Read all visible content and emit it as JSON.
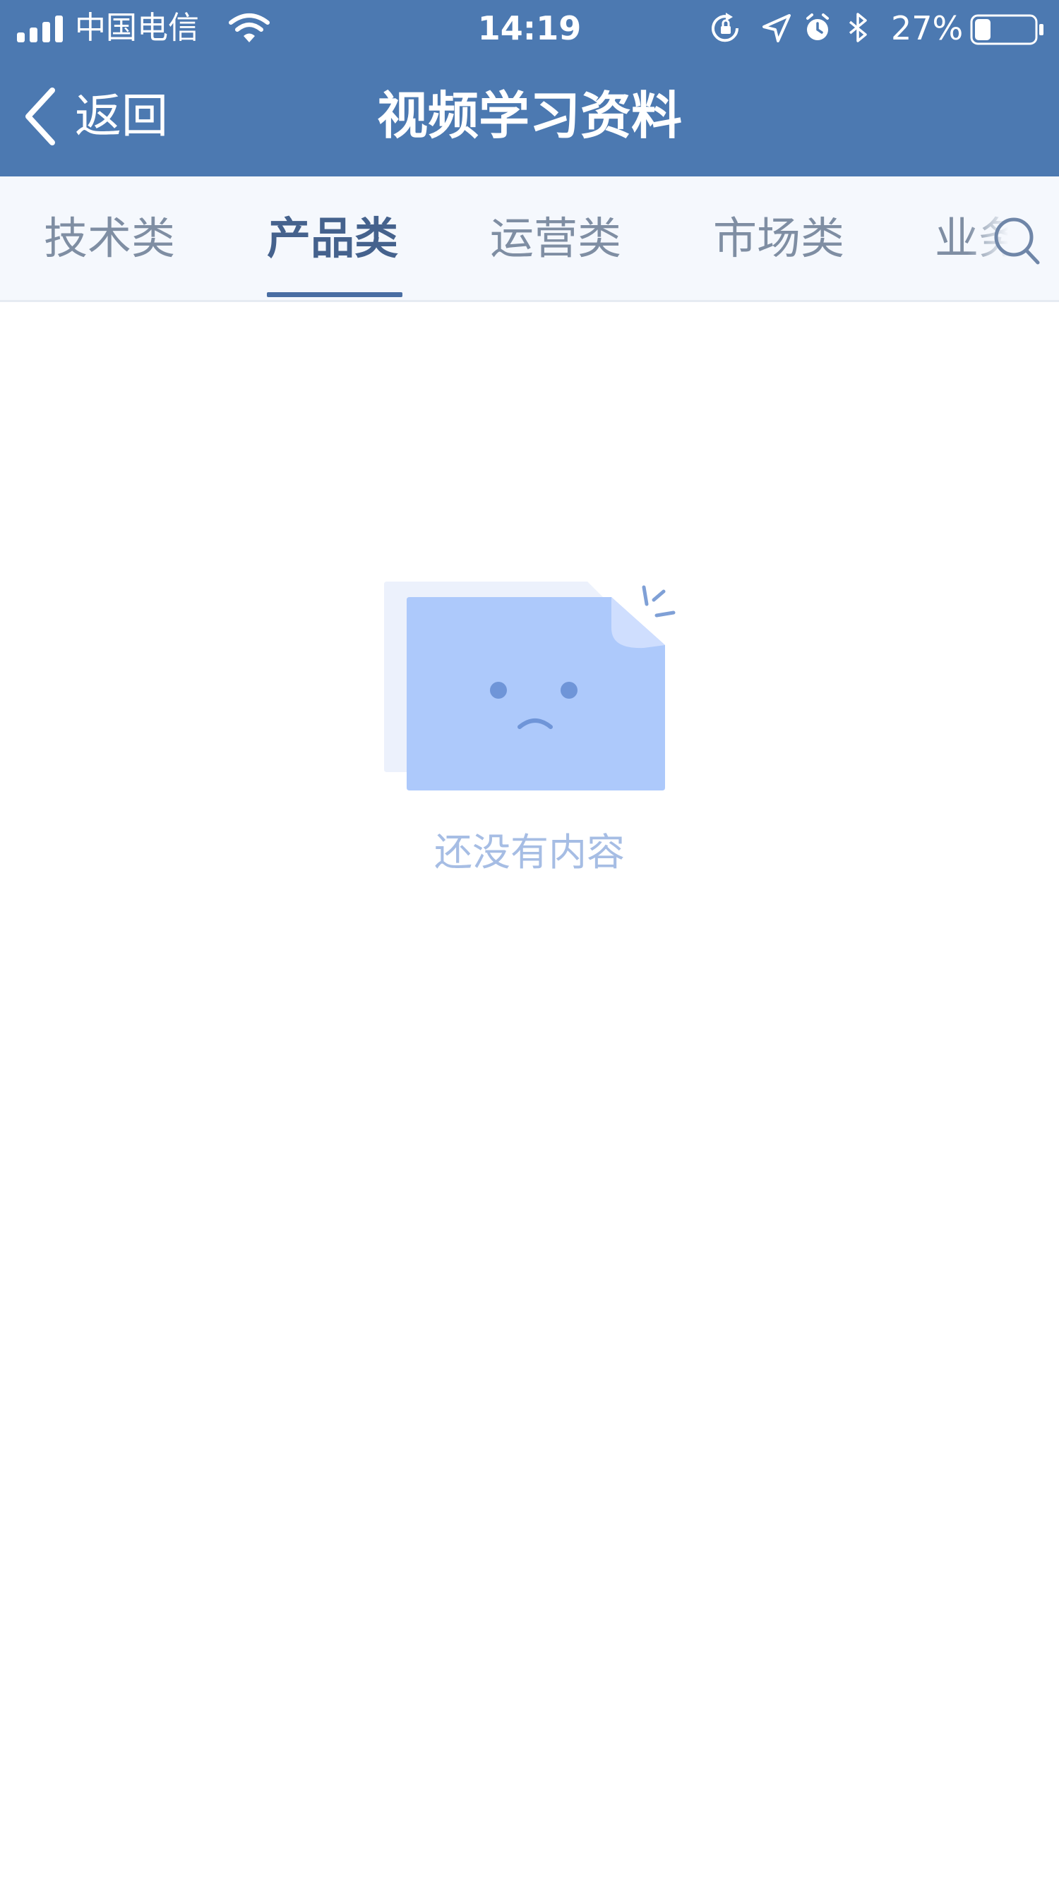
{
  "status_bar": {
    "carrier": "中国电信",
    "time": "14:19",
    "battery_percent": "27%",
    "battery_level": 0.27,
    "icons": [
      "signal-icon",
      "wifi-icon",
      "rotation-lock-icon",
      "location-icon",
      "alarm-icon",
      "bluetooth-icon",
      "battery-icon"
    ]
  },
  "nav": {
    "back_label": "返回",
    "title": "视频学习资料"
  },
  "tabs": {
    "items": [
      "技术类",
      "产品类",
      "运营类",
      "市场类",
      "业务"
    ],
    "selected": "产品类",
    "search_icon": "search-icon"
  },
  "empty_state": {
    "icon": "empty-document-icon",
    "message": "还没有内容"
  },
  "colors": {
    "header_bg": "#4c79b1",
    "tab_bar_bg": "#f5f8fd",
    "tab_active": "#45628d",
    "tab_inactive": "#7f8ea3",
    "empty_text": "#a6bde4",
    "illustration_blue": "#adc9fb"
  }
}
